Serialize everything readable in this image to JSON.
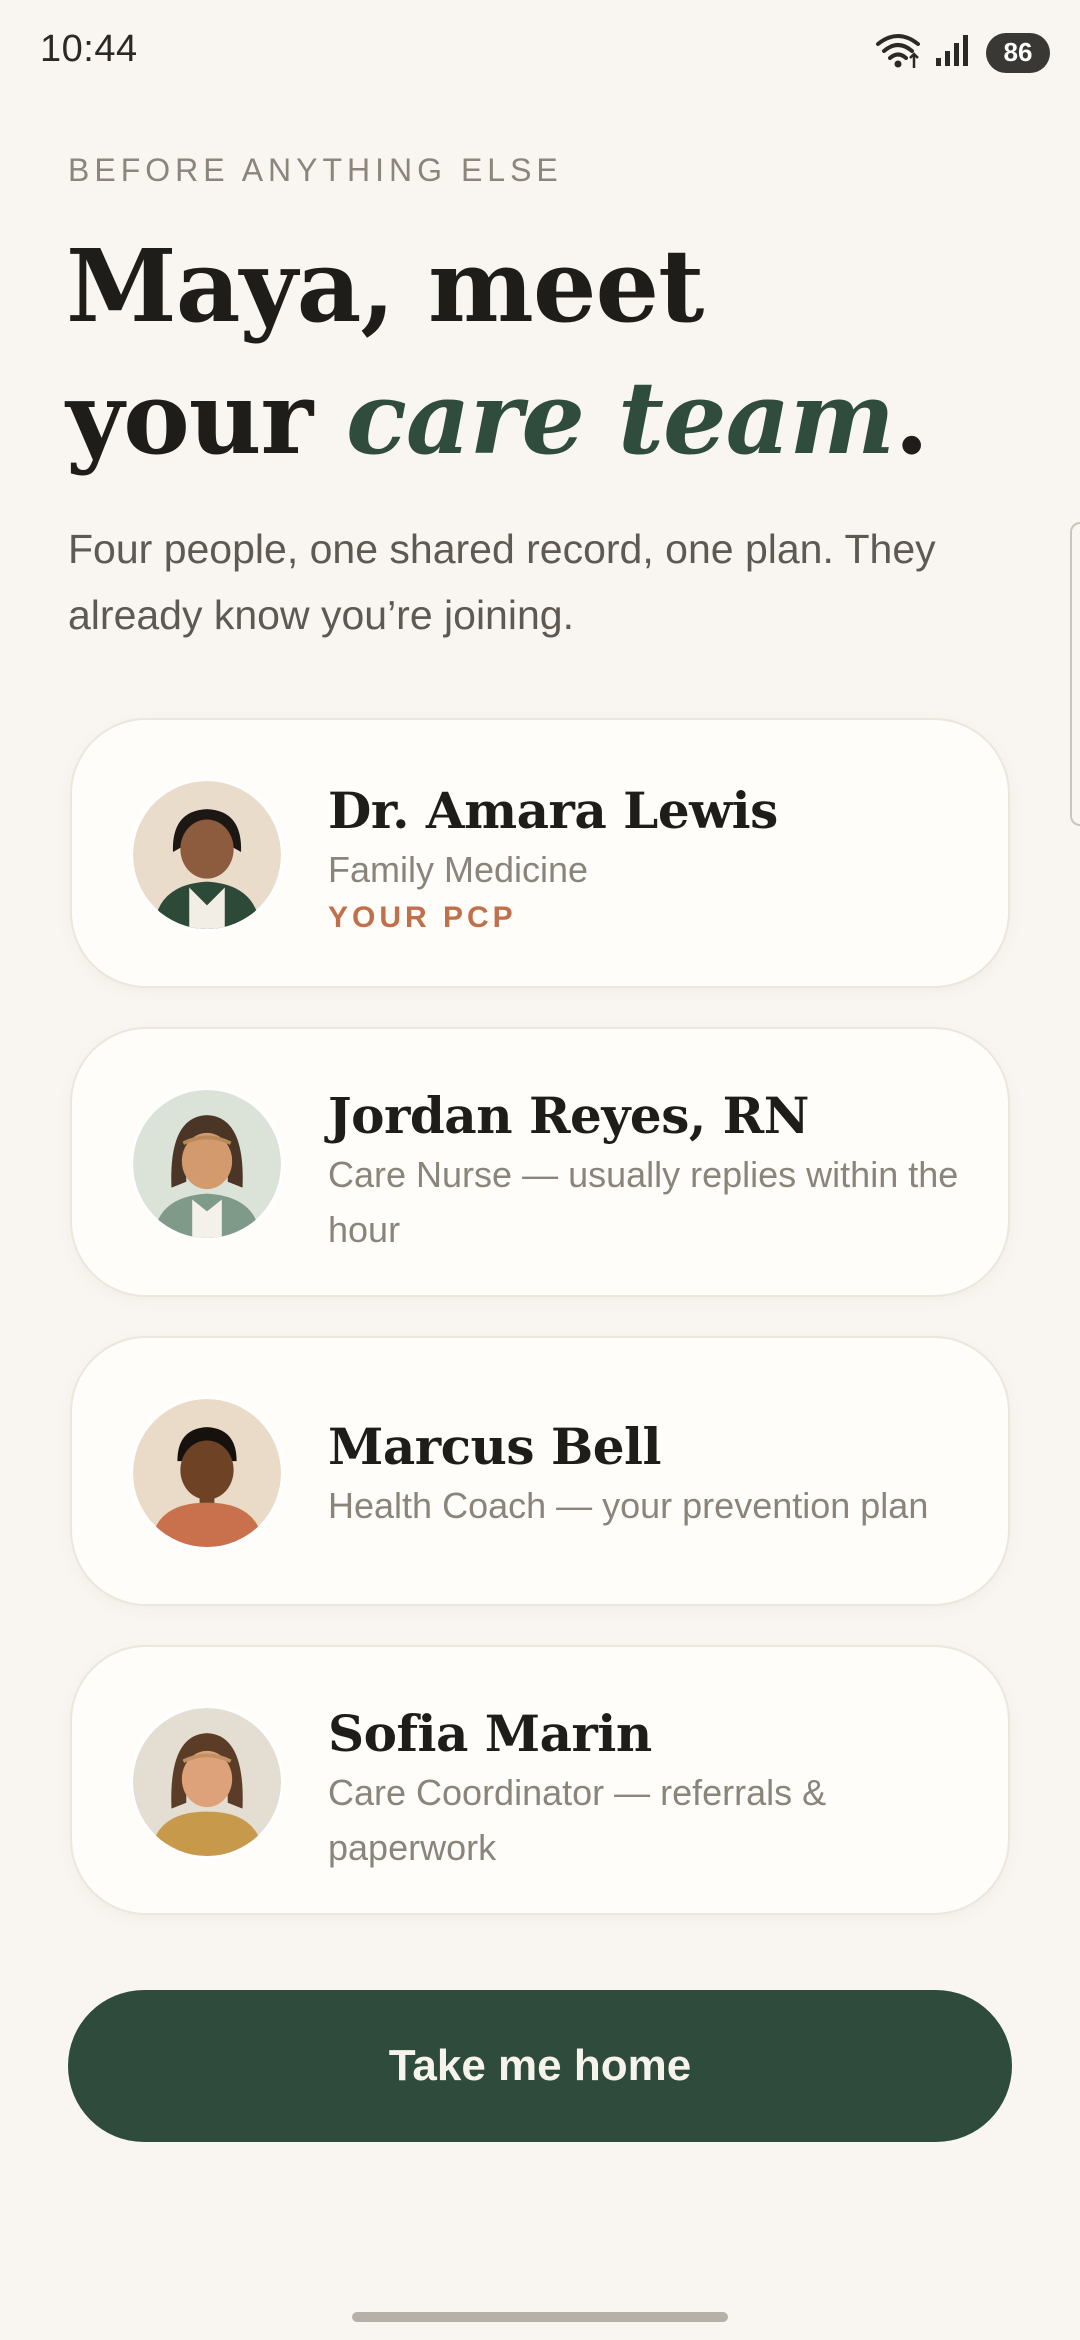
{
  "status_bar": {
    "time": "10:44",
    "battery": "86",
    "icons": [
      "wifi-icon",
      "signal-icon",
      "battery-icon"
    ]
  },
  "header": {
    "eyebrow": "BEFORE ANYTHING ELSE",
    "headline_line1": "Maya, meet",
    "headline_line2_prefix": "your ",
    "headline_line2_accent": "care team",
    "headline_line2_suffix": ".",
    "subtitle": "Four people, one shared record, one plan. They already know you’re joining."
  },
  "care_team": [
    {
      "name": "Dr. Amara Lewis",
      "role": "Family Medicine",
      "badge": "YOUR PCP"
    },
    {
      "name": "Jordan Reyes, RN",
      "role": "Care Nurse — usually replies within the hour"
    },
    {
      "name": "Marcus Bell",
      "role": "Health Coach — your prevention plan"
    },
    {
      "name": "Sofia Marin",
      "role": "Care Coordinator — referrals & paperwork"
    }
  ],
  "cta": {
    "label": "Take me home"
  },
  "colors": {
    "background": "#f9f6f1",
    "accent_green": "#2f4c3c",
    "badge_orange": "#c0704a",
    "card": "#fefdfa"
  }
}
